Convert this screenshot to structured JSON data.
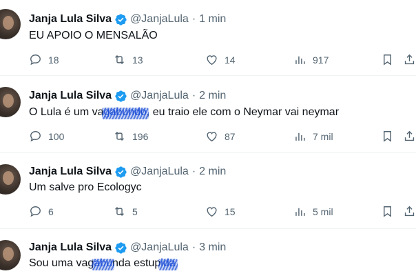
{
  "tweets": [
    {
      "name": "Janja Lula Silva",
      "handle": "@JanjaLula",
      "separator": "·",
      "time": "1 min",
      "text_parts": [
        "EU APOIO O MENSALÃO"
      ],
      "replies": "18",
      "retweets": "13",
      "likes": "14",
      "views": "917"
    },
    {
      "name": "Janja Lula Silva",
      "handle": "@JanjaLula",
      "separator": "·",
      "time": "2 min",
      "text_parts": [
        "O Lula é um va",
        "gabundo",
        ", eu traio ele com o Neymar vai neymar"
      ],
      "replies": "100",
      "retweets": "196",
      "likes": "87",
      "views": "7 mil"
    },
    {
      "name": "Janja Lula Silva",
      "handle": "@JanjaLula",
      "separator": "·",
      "time": "2 min",
      "text_parts": [
        "Um salve pro Ecologyc"
      ],
      "replies": "6",
      "retweets": "5",
      "likes": "15",
      "views": "5 mil"
    },
    {
      "name": "Janja Lula Silva",
      "handle": "@JanjaLula",
      "separator": "·",
      "time": "3 min",
      "text_parts": [
        "Sou uma vag",
        "abu",
        "nda estup",
        "ida"
      ],
      "replies": "",
      "retweets": "",
      "likes": "",
      "views": ""
    }
  ],
  "colors": {
    "verified_badge": "#1d9bf0",
    "muted_text": "#536471",
    "divider": "#eff3f4",
    "scribble": "#1d4fd6"
  },
  "icons": [
    "reply-icon",
    "retweet-icon",
    "like-icon",
    "views-icon",
    "bookmark-icon",
    "share-icon",
    "verified-badge-icon"
  ]
}
